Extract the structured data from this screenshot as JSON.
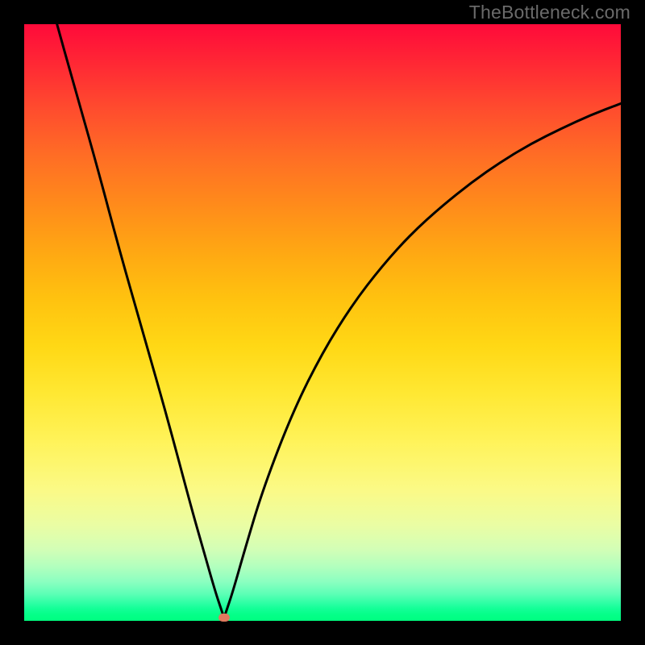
{
  "watermark": "TheBottleneck.com",
  "plot": {
    "background_gradient": {
      "from": "#ff0a3a",
      "to": "#00ff80",
      "direction": "vertical"
    },
    "curve_color": "#000000",
    "curve_stroke_width": 3,
    "frame_color": "#000000",
    "min_marker": {
      "x_frac": 0.335,
      "y_frac": 0.995,
      "color": "#e0795e"
    }
  },
  "chart_data": {
    "type": "line",
    "title": "",
    "xlabel": "",
    "ylabel": "",
    "xlim": [
      0,
      1
    ],
    "ylim": [
      0,
      1
    ],
    "series": [
      {
        "name": "bottleneck-curve",
        "x": [
          0.055,
          0.08,
          0.12,
          0.16,
          0.2,
          0.24,
          0.28,
          0.3,
          0.32,
          0.33,
          0.335,
          0.34,
          0.35,
          0.37,
          0.4,
          0.45,
          0.5,
          0.55,
          0.6,
          0.65,
          0.7,
          0.75,
          0.8,
          0.85,
          0.9,
          0.95,
          1.0
        ],
        "y": [
          1.0,
          0.91,
          0.77,
          0.62,
          0.48,
          0.34,
          0.19,
          0.12,
          0.05,
          0.02,
          0.005,
          0.02,
          0.05,
          0.12,
          0.22,
          0.35,
          0.45,
          0.53,
          0.595,
          0.65,
          0.695,
          0.735,
          0.77,
          0.8,
          0.825,
          0.848,
          0.867
        ]
      }
    ],
    "annotations": [
      {
        "type": "marker",
        "name": "minimum",
        "x": 0.335,
        "y": 0.005
      }
    ]
  }
}
